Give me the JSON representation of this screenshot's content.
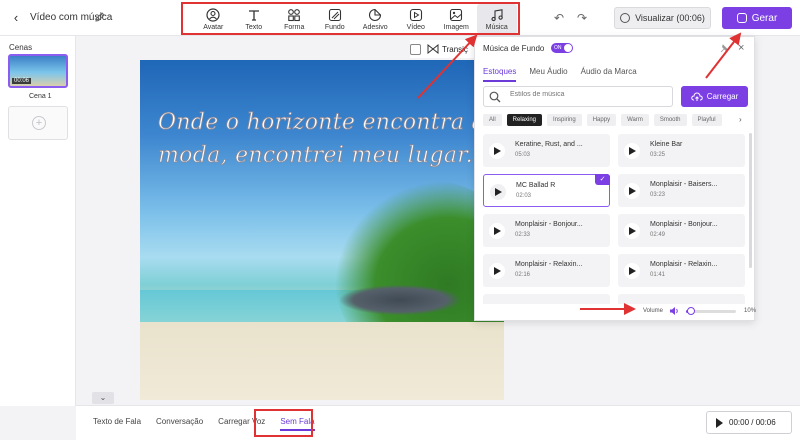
{
  "header": {
    "back_icon": "chevron-left-icon",
    "title": "Vídeo com música",
    "edit_icon": "pencil-icon",
    "tools": [
      {
        "label": "Avatar",
        "icon": "avatar-icon"
      },
      {
        "label": "Texto",
        "icon": "text-icon"
      },
      {
        "label": "Forma",
        "icon": "shapes-icon"
      },
      {
        "label": "Fundo",
        "icon": "background-icon"
      },
      {
        "label": "Adesivo",
        "icon": "sticker-icon"
      },
      {
        "label": "Vídeo",
        "icon": "video-icon"
      },
      {
        "label": "Imagem",
        "icon": "image-icon"
      },
      {
        "label": "Música",
        "icon": "music-icon",
        "active": true
      }
    ],
    "undo_icon": "undo-icon",
    "redo_icon": "redo-icon",
    "preview_label": "Visualizar (00:06)",
    "generate_label": "Gerar"
  },
  "scenes": {
    "label": "Cenas",
    "items": [
      {
        "name": "Cena 1",
        "duration": "00:06"
      }
    ],
    "add_icon": "plus-icon"
  },
  "canvas": {
    "caption": "Onde o horizonte encontra a moda, encontrei meu lugar."
  },
  "transition": {
    "label": "Transiç"
  },
  "music_panel": {
    "title": "Música de Fundo",
    "toggle_label": "ON",
    "tabs": [
      "Estoques",
      "Meu Áudio",
      "Áudio da Marca"
    ],
    "active_tab": "Estoques",
    "search_placeholder": "Estilos de música",
    "upload_label": "Carregar",
    "chips": [
      "All",
      "Relaxing",
      "Inspiring",
      "Happy",
      "Warm",
      "Smooth",
      "Playful"
    ],
    "active_chip": "Relaxing",
    "tracks": [
      {
        "name": "Keratine, Rust, and ...",
        "duration": "05:03"
      },
      {
        "name": "Kleine Bar",
        "duration": "03:25"
      },
      {
        "name": "MC Ballad R",
        "duration": "02:03",
        "selected": true
      },
      {
        "name": "Monplaisir - Baisers...",
        "duration": "03:23"
      },
      {
        "name": "Monplaisir - Bonjour...",
        "duration": "02:33"
      },
      {
        "name": "Monplaisir - Bonjour...",
        "duration": "02:49"
      },
      {
        "name": "Monplaisir - Relaxin...",
        "duration": "02:16"
      },
      {
        "name": "Monplaisir - Relaxin...",
        "duration": "01:41"
      }
    ],
    "volume_label": "Volume",
    "volume_value": "10%",
    "volume_level": 0.1
  },
  "bottom": {
    "tabs": [
      "Texto de Fala",
      "Conversação",
      "Carregar Voz",
      "Sem Fala"
    ],
    "active_tab": "Sem Fala",
    "player_time": "00:00 / 00:06"
  },
  "colors": {
    "accent": "#7b3fe4",
    "annotation": "#e03232"
  }
}
